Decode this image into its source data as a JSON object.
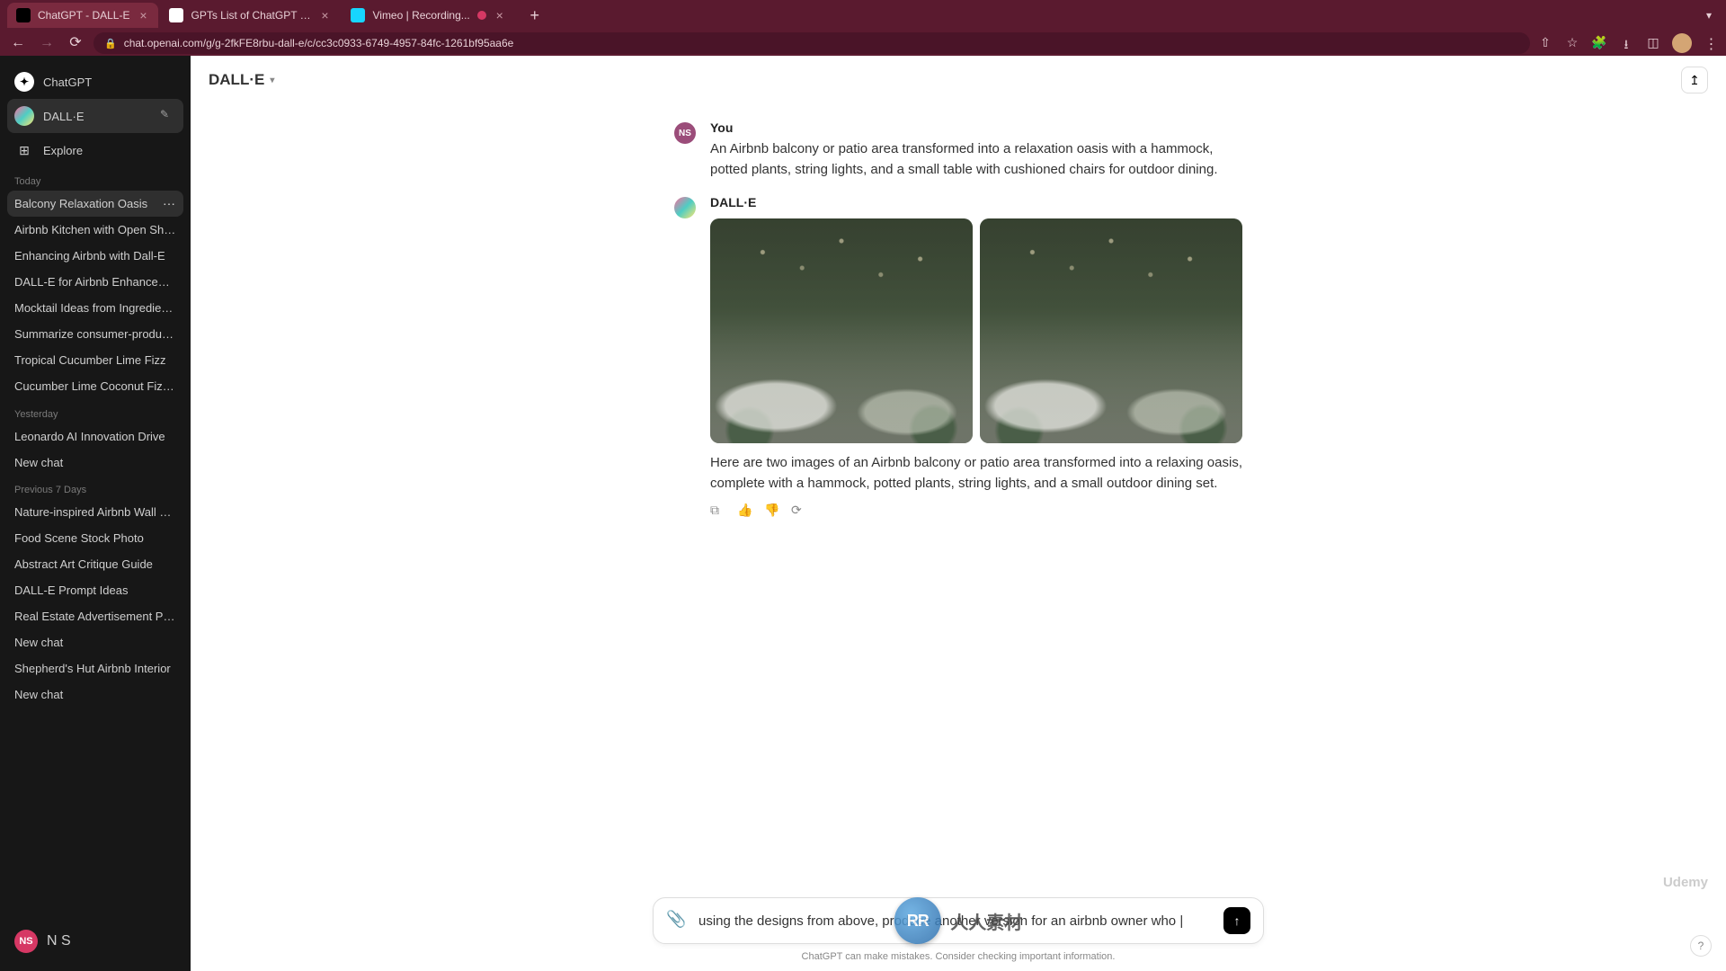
{
  "browser": {
    "tabs": [
      {
        "title": "ChatGPT - DALL-E",
        "active": true
      },
      {
        "title": "GPTs List of ChatGPT | GPTS",
        "active": false
      },
      {
        "title": "Vimeo | Recording...",
        "active": false,
        "recording": true
      }
    ],
    "url": "chat.openai.com/g/g-2fkFE8rbu-dall-e/c/cc3c0933-6749-4957-84fc-1261bf95aa6e"
  },
  "sidebar": {
    "chatgpt_label": "ChatGPT",
    "dalle_label": "DALL·E",
    "explore_label": "Explore",
    "sections": [
      {
        "label": "Today",
        "items": [
          {
            "title": "Balcony Relaxation Oasis",
            "current": true
          },
          {
            "title": "Airbnb Kitchen with Open Shelvin"
          },
          {
            "title": "Enhancing Airbnb with Dall-E"
          },
          {
            "title": "DALL-E for Airbnb Enhancement"
          },
          {
            "title": "Mocktail Ideas from Ingredients"
          },
          {
            "title": "Summarize consumer-producer c"
          },
          {
            "title": "Tropical Cucumber Lime Fizz"
          },
          {
            "title": "Cucumber Lime Coconut Fizz 🍹"
          }
        ]
      },
      {
        "label": "Yesterday",
        "items": [
          {
            "title": "Leonardo AI Innovation Drive"
          },
          {
            "title": "New chat"
          }
        ]
      },
      {
        "label": "Previous 7 Days",
        "items": [
          {
            "title": "Nature-inspired Airbnb Wall Mura"
          },
          {
            "title": "Food Scene Stock Photo"
          },
          {
            "title": "Abstract Art Critique Guide"
          },
          {
            "title": "DALL-E Prompt Ideas"
          },
          {
            "title": "Real Estate Advertisement Poste"
          },
          {
            "title": "New chat"
          },
          {
            "title": "Shepherd's Hut Airbnb Interior"
          },
          {
            "title": "New chat"
          }
        ]
      }
    ],
    "user": {
      "initials": "NS",
      "name": "N S"
    }
  },
  "header": {
    "model": "DALL·E"
  },
  "chat": {
    "user_label": "You",
    "user_initials": "NS",
    "user_message": "An Airbnb balcony or patio area transformed into a relaxation oasis with a hammock, potted plants, string lights, and a small table with cushioned chairs for outdoor dining.",
    "assistant_label": "DALL·E",
    "assistant_message": "Here are two images of an Airbnb balcony or patio area transformed into a relaxing oasis, complete with a hammock, potted plants, string lights, and a small outdoor dining set."
  },
  "input": {
    "value": "using the designs from above, produce another version for an airbnb owner who |",
    "disclaimer": "ChatGPT can make mistakes. Consider checking important information."
  },
  "watermark": {
    "badge": "RR",
    "text": "人人素材"
  },
  "udemy_wm": "Udemy"
}
